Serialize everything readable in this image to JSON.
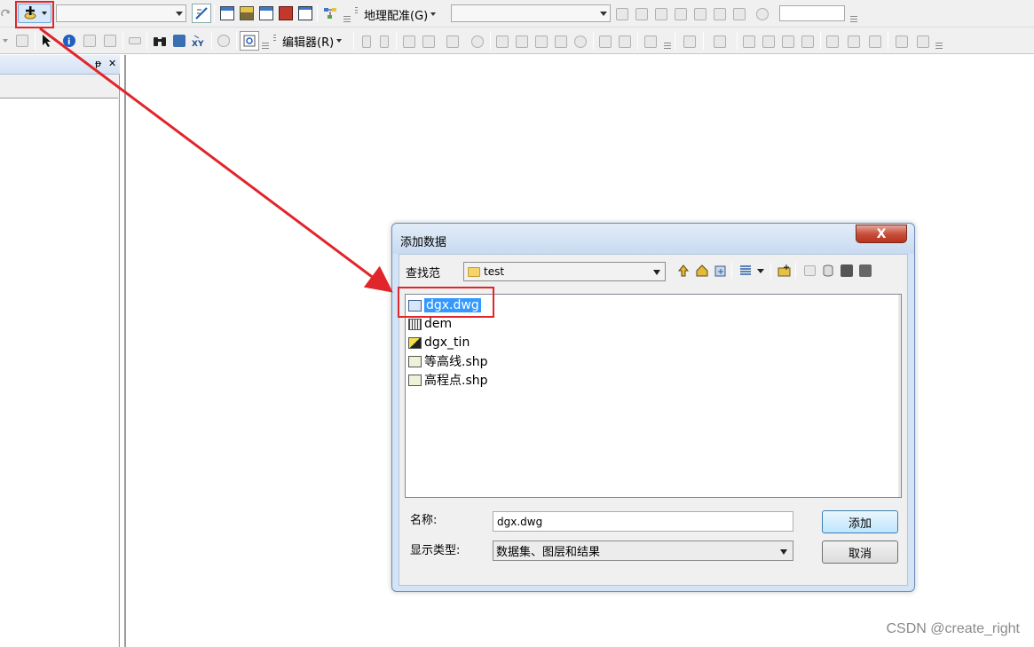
{
  "toolbar_top": {
    "layer_combo_value": "",
    "georeferencing_menu": "地理配准(G)",
    "georef_layer_combo_value": "",
    "scale_input_value": ""
  },
  "toolbar_second": {
    "editor_menu": "编辑器(R)"
  },
  "left_panel": {
    "pin_glyph": "ᵽ",
    "close_glyph": "✕"
  },
  "dialog": {
    "title": "添加数据",
    "close_glyph": "X",
    "look_in_label": "查找范",
    "look_in_value": "test",
    "files": [
      {
        "name": "dgx.dwg",
        "icon": "cad-drawing-icon",
        "selected": true
      },
      {
        "name": "dem",
        "icon": "raster-icon",
        "selected": false
      },
      {
        "name": "dgx_tin",
        "icon": "tin-icon",
        "selected": false
      },
      {
        "name": "等高线.shp",
        "icon": "polyline-shapefile-icon",
        "selected": false
      },
      {
        "name": "高程点.shp",
        "icon": "point-shapefile-icon",
        "selected": false
      }
    ],
    "name_label": "名称:",
    "name_value": "dgx.dwg",
    "type_label": "显示类型:",
    "type_value": "数据集、图层和结果",
    "add_button": "添加",
    "cancel_button": "取消"
  },
  "watermark": "CSDN @create_right",
  "colors": {
    "highlight": "#e0262b",
    "selection": "#3399ff",
    "dialog_frame": "#d4e3f5"
  }
}
